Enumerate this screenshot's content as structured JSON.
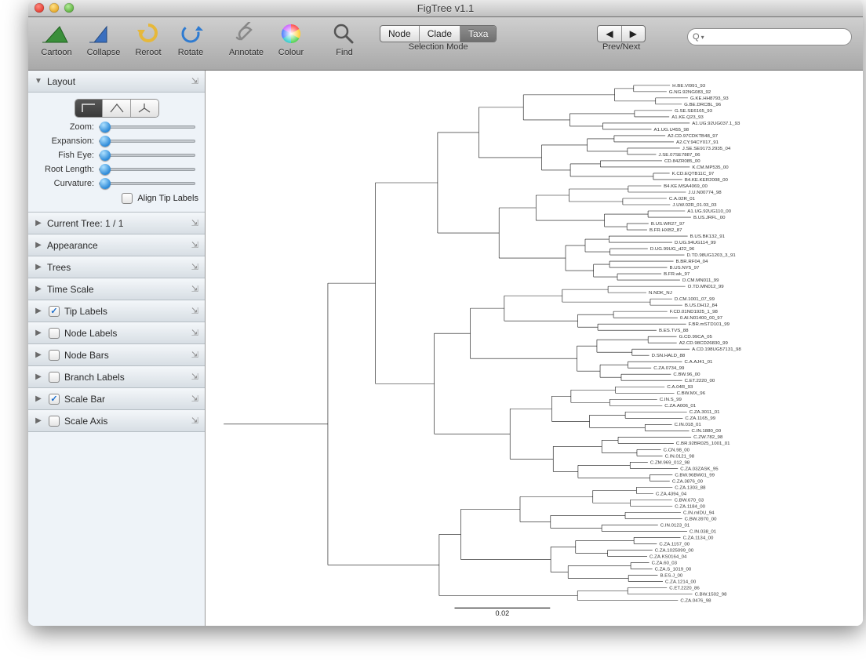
{
  "window": {
    "title": "FigTree v1.1"
  },
  "toolbar": {
    "buttons": {
      "cartoon": "Cartoon",
      "collapse": "Collapse",
      "reroot": "Reroot",
      "rotate": "Rotate",
      "annotate": "Annotate",
      "colour": "Colour",
      "find": "Find"
    },
    "selection_mode": {
      "label": "Selection Mode",
      "options": [
        "Node",
        "Clade",
        "Taxa"
      ],
      "selected": "Taxa"
    },
    "prevnext": {
      "label": "Prev/Next"
    },
    "search": {
      "placeholder": "",
      "glyph": "Q",
      "caret": "▾"
    }
  },
  "sidebar": {
    "layout": {
      "title": "Layout",
      "controls": {
        "zoom": "Zoom:",
        "expansion": "Expansion:",
        "fisheye": "Fish Eye:",
        "rootlength": "Root Length:",
        "curvature": "Curvature:",
        "align": "Align Tip Labels"
      }
    },
    "panels": {
      "current_tree": "Current Tree: 1 / 1",
      "appearance": "Appearance",
      "trees": "Trees",
      "timescale": "Time Scale",
      "tip_labels": "Tip Labels",
      "node_labels": "Node Labels",
      "node_bars": "Node Bars",
      "branch_labels": "Branch Labels",
      "scale_bar": "Scale Bar",
      "scale_axis": "Scale Axis"
    },
    "checked": {
      "tip_labels": true,
      "scale_bar": true
    }
  },
  "tree": {
    "scale_label": "0.02",
    "tips": [
      "H.BE.VI991_93",
      "G.NG.92NG083_92",
      "G.KE.HH8793_93",
      "G.BE.DRCBL_96",
      "G.SE.SE6165_93",
      "A1.KE.Q23_93",
      "A1.UG.92UG037.1_93",
      "A1.UG.U455_98",
      "A2.CD.97CDKTB48_97",
      "A2.CY.94CY017_91",
      "J.SE.SE9173.2935_04",
      "J.SE.07SE7887_06",
      "CD.84ZR085_00",
      "K.CM.MP535_00",
      "K.CD.EQTB11C_97",
      "B4.KE.KER2008_00",
      "B4.KE.MSA4069_00",
      "J.U.N00774_98",
      "C.A.02R_01",
      "J.UW.02R_01.03_03",
      "A1.UG.92UG110_00",
      "B.US.JRFL_00",
      "B.US.WR27_97",
      "B.FR.HXB2_87",
      "B.US.BK132_91",
      "D.UG.94UG114_99",
      "D.UG.99UG_d22_96",
      "D.TD.98UG1203_3_91",
      "B.BR.RF04_04",
      "B.US.NY5_97",
      "B.FR.wk_97",
      "D.CM.MN011_99",
      "O.TD.MN012_99",
      "N.NDK_NJ",
      "D.CM.1001_07_99",
      "B.US.DH12_84",
      "F.CD.01ND1925_1_98",
      "0.AI.N01400_00_97",
      "F.BR.mSTD101_99",
      "B.ES.TVS_88",
      "G.CD.99CA_05",
      "A2.CD.98CD26830_99",
      "A.CD.198UG57131_98",
      "D.SN.HALD_88",
      "C.A.AJ41_01",
      "C.ZA.0734_99",
      "C.BW.96_00",
      "C.ET.2220_00",
      "C.A.04R_93",
      "C.BW.MX_96",
      "C.IN.S_99",
      "C.ZA.A006_01",
      "C.ZA.3011_01",
      "C.ZA.1165_99",
      "C.IN.018_01",
      "C.IN.1880_00",
      "C.ZW.782_98",
      "C.BR.92BR025_1001_01",
      "C.CN.98_00",
      "C.IN.0121_98",
      "C.ZM.969_012_98",
      "C.ZA.03ZASK_95",
      "C.BW.96BW01_99",
      "C.ZA.3876_00",
      "C.ZA.1303_88",
      "C.ZA.4394_04",
      "C.BW.670_03",
      "C.ZA.1184_00",
      "C.IN.mIDU_94",
      "C.BW.3970_00",
      "C.IN.0123_01",
      "C.IN.038_01",
      "C.ZA.1134_00",
      "C.ZA.1157_00",
      "C.ZA.1025099_00",
      "C.ZA.KS0164_04",
      "C.ZA.60_03",
      "C.ZA.S_1019_00",
      "B.ES.J_00",
      "C.ZA.1214_00",
      "C.ET.2220_86",
      "C.BW.1502_98",
      "C.ZA.0476_98"
    ]
  }
}
